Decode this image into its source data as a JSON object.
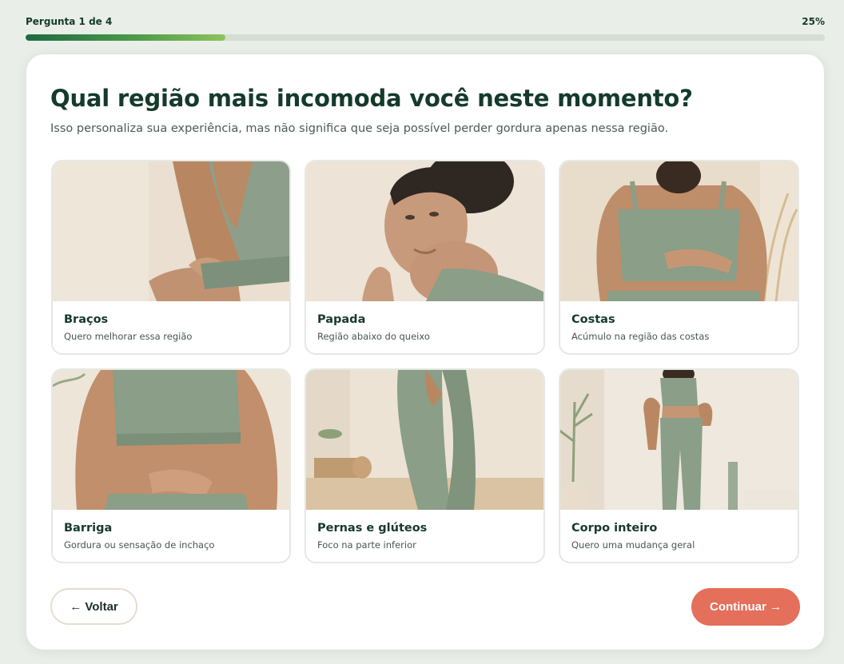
{
  "progress": {
    "label": "Pergunta 1 de 4",
    "percent_label": "25%",
    "fraction": 0.25
  },
  "question": {
    "title": "Qual região mais incomoda você neste momento?",
    "subtitle": "Isso personaliza sua experiência, mas não significa que seja possível perder gordura apenas nessa região."
  },
  "options": [
    {
      "title": "Braços",
      "desc": "Quero melhorar essa região",
      "image": "arms-photo"
    },
    {
      "title": "Papada",
      "desc": "Região abaixo do queixo",
      "image": "chin-photo"
    },
    {
      "title": "Costas",
      "desc": "Acúmulo na região das costas",
      "image": "back-photo"
    },
    {
      "title": "Barriga",
      "desc": "Gordura ou sensação de inchaço",
      "image": "belly-photo"
    },
    {
      "title": "Pernas e glúteos",
      "desc": "Foco na parte inferior",
      "image": "legs-photo"
    },
    {
      "title": "Corpo inteiro",
      "desc": "Quero uma mudança geral",
      "image": "fullbody-photo"
    }
  ],
  "nav": {
    "back_label": "← Voltar",
    "next_label": "Continuar →"
  },
  "colors": {
    "accent": "#e46f5b",
    "heading": "#143a2b",
    "progress_fill": "#4d9a4b",
    "outfit": "#8a9e88"
  }
}
